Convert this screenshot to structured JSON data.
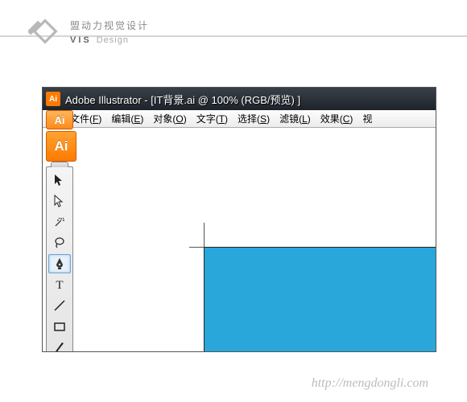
{
  "brand": {
    "cn": "盟动力视觉设计",
    "en_bold": "VIS",
    "en_rest": "Design"
  },
  "titlebar": {
    "icon_text": "Ai",
    "text": "Adobe Illustrator - [IT背景.ai @ 100% (RGB/预览) ]"
  },
  "menu": {
    "icon_text": "▦",
    "items": [
      {
        "label": "文件",
        "key": "F"
      },
      {
        "label": "编辑",
        "key": "E"
      },
      {
        "label": "对象",
        "key": "O"
      },
      {
        "label": "文字",
        "key": "T"
      },
      {
        "label": "选择",
        "key": "S"
      },
      {
        "label": "滤镜",
        "key": "L"
      },
      {
        "label": "效果",
        "key": "C"
      },
      {
        "label": "视",
        "key": ""
      }
    ]
  },
  "dock": {
    "top_badge": "Ai",
    "second_badge": "Ai"
  },
  "tools": [
    {
      "name": "selection-tool",
      "selected": false
    },
    {
      "name": "direct-selection-tool",
      "selected": false
    },
    {
      "name": "magic-wand-tool",
      "selected": false
    },
    {
      "name": "lasso-tool",
      "selected": false
    },
    {
      "name": "pen-tool",
      "selected": true
    },
    {
      "name": "type-tool",
      "selected": false
    },
    {
      "name": "line-tool",
      "selected": false
    },
    {
      "name": "rectangle-tool",
      "selected": false
    },
    {
      "name": "paintbrush-tool",
      "selected": false
    }
  ],
  "canvas": {
    "fill_color": "#29a7da"
  },
  "footer": {
    "url": "http://mengdongli.com"
  }
}
